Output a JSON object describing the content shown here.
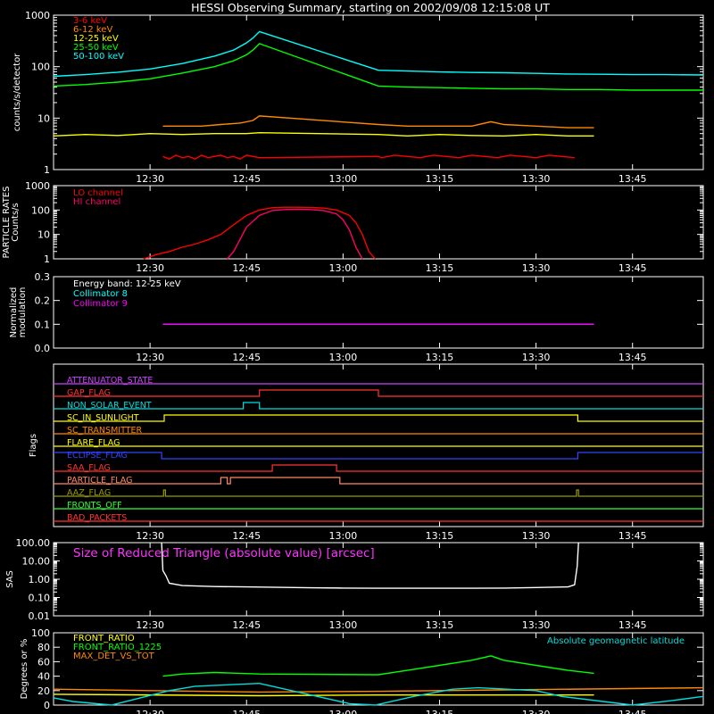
{
  "title": "HESSI Observing Summary, starting on 2002/09/08 12:15:08 UT",
  "x_axis": {
    "ticks": [
      "12:30",
      "12:45",
      "13:00",
      "13:15",
      "13:30",
      "13:45"
    ],
    "tick_minutes": [
      15,
      30,
      45,
      60,
      75,
      90
    ],
    "range_minutes": [
      0,
      101
    ]
  },
  "chart_data": [
    {
      "type": "line",
      "name": "counts",
      "ylabel": "counts/s/detector",
      "scale": "log",
      "ylim": [
        1,
        1000
      ],
      "ytick_labels": [
        "1",
        "10",
        "100",
        "1000"
      ],
      "yticks": [
        1,
        10,
        100,
        1000
      ],
      "legend_placement": "top-left",
      "series": [
        {
          "name": "3-6 keV",
          "color": "#ff0000",
          "x": [
            17,
            18,
            19,
            20,
            21,
            22,
            23,
            24,
            25,
            26,
            27,
            28,
            29,
            30,
            31,
            32,
            50.5,
            51,
            53,
            55,
            57,
            59,
            61,
            63,
            65,
            67,
            69,
            71,
            73,
            75,
            77,
            79,
            81
          ],
          "y": [
            1.8,
            1.6,
            1.9,
            1.7,
            1.8,
            1.6,
            1.9,
            1.7,
            1.8,
            1.9,
            1.7,
            1.8,
            1.6,
            1.9,
            1.8,
            1.7,
            1.8,
            1.7,
            1.9,
            1.8,
            1.7,
            1.9,
            1.8,
            1.7,
            1.9,
            1.8,
            1.7,
            1.9,
            1.8,
            1.7,
            1.9,
            1.8,
            1.7
          ]
        },
        {
          "name": "6-12 keV",
          "color": "#ff8800",
          "x": [
            17,
            20,
            23,
            26,
            29,
            31,
            32,
            50.5,
            55,
            60,
            65,
            68,
            70,
            75,
            80,
            84
          ],
          "y": [
            7,
            7,
            7,
            7.5,
            8,
            9,
            11,
            7.5,
            7,
            7,
            7,
            8.5,
            7.5,
            7,
            6.5,
            6.5
          ]
        },
        {
          "name": "12-25 keV",
          "color": "#ffff00",
          "x": [
            0,
            5,
            10,
            15,
            20,
            25,
            30,
            32,
            50.5,
            55,
            60,
            65,
            70,
            75,
            80,
            84
          ],
          "y": [
            4.5,
            4.8,
            4.6,
            5,
            4.8,
            5,
            5,
            5.2,
            4.8,
            4.5,
            4.8,
            4.6,
            4.5,
            4.8,
            4.5,
            4.5
          ]
        },
        {
          "name": "25-50 keV",
          "color": "#00ff00",
          "x": [
            0,
            5,
            10,
            15,
            20,
            25,
            28,
            30,
            31,
            32,
            50.5,
            55,
            60,
            65,
            70,
            75,
            80,
            85,
            90,
            95,
            101
          ],
          "y": [
            42,
            45,
            50,
            58,
            75,
            100,
            130,
            170,
            210,
            280,
            42,
            40,
            39,
            38,
            37,
            37,
            36,
            36,
            35,
            35,
            35
          ]
        },
        {
          "name": "50-100 keV",
          "color": "#00ffff",
          "x": [
            0,
            5,
            10,
            15,
            20,
            25,
            28,
            30,
            31,
            32,
            50.5,
            55,
            60,
            65,
            70,
            75,
            80,
            85,
            90,
            95,
            101
          ],
          "y": [
            65,
            70,
            78,
            90,
            115,
            160,
            210,
            290,
            360,
            480,
            85,
            82,
            79,
            77,
            76,
            74,
            72,
            71,
            70,
            70,
            69
          ]
        }
      ]
    },
    {
      "type": "line",
      "name": "particle-rates",
      "ylabel": "PARTICLE RATES Counts/s",
      "scale": "log",
      "ylim": [
        1,
        1000
      ],
      "ytick_labels": [
        "1",
        "10",
        "100",
        "1000"
      ],
      "yticks": [
        1,
        10,
        100,
        1000
      ],
      "legend_placement": "top-left",
      "series": [
        {
          "name": "LO channel",
          "color": "#ff0000",
          "x": [
            14,
            16,
            18,
            20,
            22,
            24,
            26,
            28,
            30,
            32,
            34,
            36,
            38,
            40,
            42,
            44,
            46,
            47,
            48,
            49,
            50
          ],
          "y": [
            1,
            1.5,
            2,
            3,
            4,
            6,
            10,
            25,
            60,
            100,
            125,
            130,
            130,
            128,
            120,
            100,
            60,
            30,
            10,
            2,
            1
          ]
        },
        {
          "name": "HI channel",
          "color": "#ff0066",
          "x": [
            27,
            28,
            30,
            32,
            34,
            36,
            38,
            40,
            42,
            44,
            45,
            46,
            47,
            48
          ],
          "y": [
            1,
            2,
            20,
            60,
            95,
            105,
            108,
            105,
            95,
            70,
            40,
            15,
            3,
            1
          ]
        }
      ]
    },
    {
      "type": "line",
      "name": "modulation",
      "ylabel": "Normalized modulation",
      "ylim": [
        0,
        0.3
      ],
      "ytick_labels": [
        "0.0",
        "0.1",
        "0.2",
        "0.3"
      ],
      "yticks": [
        0,
        0.1,
        0.2,
        0.3
      ],
      "annotation": "Energy band: 12-25 keV",
      "legend_placement": "top-left",
      "series": [
        {
          "name": "Collimator 8",
          "color": "#00ffff",
          "x": [
            17,
            32,
            50.5,
            84
          ],
          "y": [
            0.1,
            0.1,
            0.1,
            0.1
          ]
        },
        {
          "name": "Collimator 9",
          "color": "#ff00ff",
          "x": [
            17,
            32,
            50.5,
            84
          ],
          "y": [
            0.1,
            0.1,
            0.1,
            0.1
          ]
        }
      ]
    },
    {
      "type": "line",
      "name": "flags",
      "ylabel": "Flags",
      "flags": [
        {
          "name": "ATTENUATOR_STATE",
          "color": "#cc44ff",
          "segments": [
            [
              0,
              101,
              0
            ]
          ]
        },
        {
          "name": "GAP_FLAG",
          "color": "#ff3333",
          "segments": [
            [
              0,
              32,
              0
            ],
            [
              32,
              50.5,
              1
            ],
            [
              50.5,
              101,
              0
            ]
          ]
        },
        {
          "name": "NON_SOLAR_EVENT",
          "color": "#00dddd",
          "segments": [
            [
              0,
              29.5,
              0
            ],
            [
              29.5,
              32,
              1
            ],
            [
              32,
              101,
              0
            ]
          ]
        },
        {
          "name": "SC_IN_SUNLIGHT",
          "color": "#ffff00",
          "segments": [
            [
              0,
              17.2,
              0
            ],
            [
              17.2,
              81.5,
              1
            ],
            [
              81.5,
              101,
              0
            ]
          ]
        },
        {
          "name": "SC_TRANSMITTER",
          "color": "#ff8800",
          "segments": [
            [
              0,
              101,
              0
            ]
          ]
        },
        {
          "name": "FLARE_FLAG",
          "color": "#ffff00",
          "segments": [
            [
              0,
              101,
              0
            ]
          ]
        },
        {
          "name": "ECLIPSE_FLAG",
          "color": "#3344ff",
          "segments": [
            [
              0,
              16.8,
              1
            ],
            [
              16.8,
              81.5,
              0
            ],
            [
              81.5,
              101,
              1
            ]
          ]
        },
        {
          "name": "SAA_FLAG",
          "color": "#ff3333",
          "segments": [
            [
              0,
              34,
              0
            ],
            [
              34,
              44,
              1
            ],
            [
              44,
              101,
              0
            ]
          ]
        },
        {
          "name": "PARTICLE_FLAG",
          "color": "#ff8866",
          "segments": [
            [
              0,
              26,
              0
            ],
            [
              26,
              27,
              1
            ],
            [
              27,
              27.5,
              0
            ],
            [
              27.5,
              44.5,
              1
            ],
            [
              44.5,
              101,
              0
            ]
          ]
        },
        {
          "name": "AAZ_FLAG",
          "color": "#999900",
          "segments": [
            [
              0,
              17.1,
              0
            ],
            [
              17.1,
              17.4,
              1
            ],
            [
              17.4,
              81.3,
              0
            ],
            [
              81.3,
              81.6,
              1
            ],
            [
              81.6,
              101,
              0
            ]
          ]
        },
        {
          "name": "FRONTS_OFF",
          "color": "#33ff33",
          "segments": [
            [
              0,
              101,
              0
            ]
          ]
        },
        {
          "name": "BAD_PACKETS",
          "color": "#ff3333",
          "segments": [
            [
              0,
              101,
              0
            ]
          ]
        }
      ]
    },
    {
      "type": "line",
      "name": "sas",
      "ylabel": "SAS",
      "scale": "log",
      "ylim": [
        0.01,
        100
      ],
      "ytick_labels": [
        "0.01",
        "0.10",
        "1.00",
        "10.00",
        "100.00"
      ],
      "yticks": [
        0.01,
        0.1,
        1,
        10,
        100
      ],
      "annotation": "Size of Reduced Triangle (absolute value) [arcsec]",
      "series": [
        {
          "name": "",
          "color": "#ffffff",
          "x": [
            16.8,
            17,
            17.5,
            18,
            20,
            25,
            30,
            35,
            40,
            45,
            50,
            55,
            60,
            65,
            70,
            75,
            80,
            81,
            81.4,
            81.6
          ],
          "y": [
            100,
            3,
            1.5,
            0.6,
            0.45,
            0.4,
            0.38,
            0.36,
            0.34,
            0.33,
            0.32,
            0.32,
            0.32,
            0.32,
            0.33,
            0.35,
            0.38,
            0.5,
            5,
            100
          ]
        }
      ]
    },
    {
      "type": "line",
      "name": "ratios",
      "ylabel": "Degrees or %",
      "ylim": [
        0,
        100
      ],
      "ytick_labels": [
        "0",
        "20",
        "40",
        "60",
        "80",
        "100"
      ],
      "yticks": [
        0,
        20,
        40,
        60,
        80,
        100
      ],
      "annotation": "Absolute geomagnetic latitude",
      "legend_placement": "top-left",
      "series": [
        {
          "name": "FRONT_RATIO",
          "color": "#ffff00",
          "x": [
            0,
            32,
            50.5,
            84
          ],
          "y": [
            15,
            13,
            14,
            14
          ]
        },
        {
          "name": "FRONT_RATIO_1225",
          "color": "#00ff00",
          "x": [
            17,
            20,
            25,
            32,
            50.5,
            55,
            60,
            65,
            68,
            70,
            75,
            80,
            84
          ],
          "y": [
            40,
            43,
            45,
            43,
            42,
            48,
            55,
            62,
            68,
            62,
            55,
            48,
            44
          ]
        },
        {
          "name": "MAX_DET_VS_TOT",
          "color": "#ff8800",
          "x": [
            0,
            15,
            32,
            50.5,
            70,
            101
          ],
          "y": [
            22,
            20,
            18,
            19,
            21,
            24
          ]
        },
        {
          "name": "Absolute geomagnetic latitude",
          "color": "#00dddd",
          "x": [
            0,
            3,
            9,
            18,
            22,
            32,
            38,
            46,
            50,
            56,
            62,
            66,
            75,
            79,
            90,
            96,
            101
          ],
          "y": [
            10,
            5,
            0,
            20,
            26,
            30,
            18,
            2,
            0,
            12,
            22,
            24,
            20,
            12,
            0,
            6,
            12
          ]
        }
      ]
    }
  ]
}
